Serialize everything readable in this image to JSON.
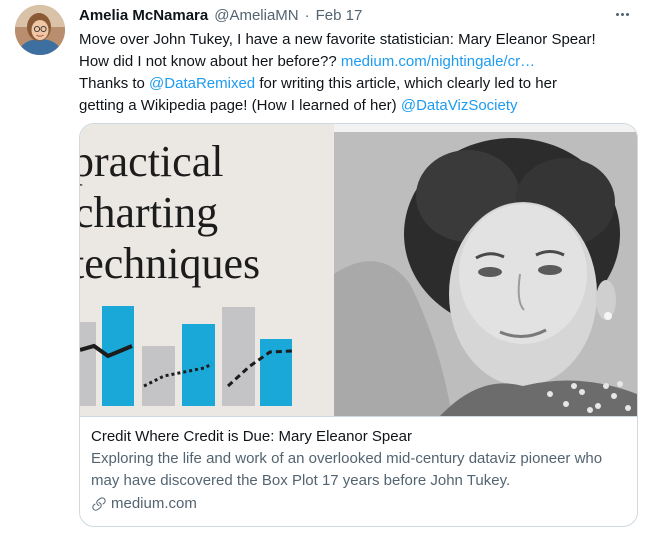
{
  "author": {
    "name": "Amelia McNamara",
    "handle": "@AmeliaMN",
    "separator": "·",
    "date": "Feb 17"
  },
  "tweet": {
    "line1": "Move over John Tukey, I have a new favorite statistician: Mary Eleanor Spear!",
    "line2_text": "How did I not know about her before?? ",
    "line2_link": "medium.com/nightingale/cr…",
    "line3_pre": "Thanks to ",
    "line3_mention": "@DataRemixed",
    "line3_post": " for writing this article, which clearly led to her",
    "line4_text": "getting a Wikipedia page! (How I learned of her) ",
    "line4_mention": "@DataVizSociety"
  },
  "card": {
    "image_headline": [
      "practical",
      "charting",
      "techniques"
    ],
    "title": "Credit Where Credit is Due: Mary Eleanor Spear",
    "description": "Exploring the life and work of an overlooked mid-century dataviz pioneer who may have discovered the Box Plot 17 years before John Tukey.",
    "domain": "medium.com",
    "domain_icon": "link-icon"
  },
  "colors": {
    "link": "#1d9bf0",
    "text": "#0f1419",
    "secondary": "#536471",
    "border": "#cfd9de",
    "bar_blue": "#1aa8d8",
    "bar_gray": "#c4c4c6"
  }
}
